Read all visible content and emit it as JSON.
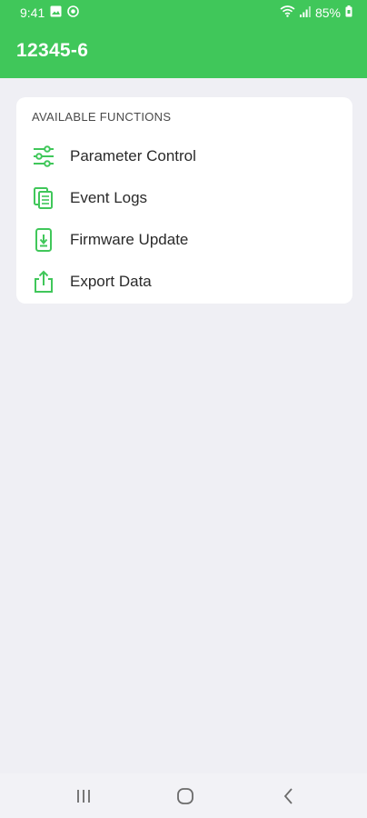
{
  "status_bar": {
    "time": "9:41",
    "battery": "85%",
    "icons": [
      "image-icon",
      "sync-icon",
      "wifi-icon",
      "signal-icon",
      "battery-icon"
    ]
  },
  "app_bar": {
    "title": "12345-6"
  },
  "functions": {
    "header": "AVAILABLE FUNCTIONS",
    "items": [
      {
        "label": "Parameter Control",
        "icon": "sliders-icon"
      },
      {
        "label": "Event Logs",
        "icon": "documents-icon"
      },
      {
        "label": "Firmware Update",
        "icon": "phone-download-icon"
      },
      {
        "label": "Export Data",
        "icon": "share-icon"
      }
    ]
  },
  "nav_bar": {
    "icons": [
      "recents-icon",
      "home-icon",
      "back-icon"
    ]
  },
  "colors": {
    "accent": "#40c75a",
    "background": "#efeff4",
    "card": "#ffffff",
    "text": "#2a2a2a"
  }
}
